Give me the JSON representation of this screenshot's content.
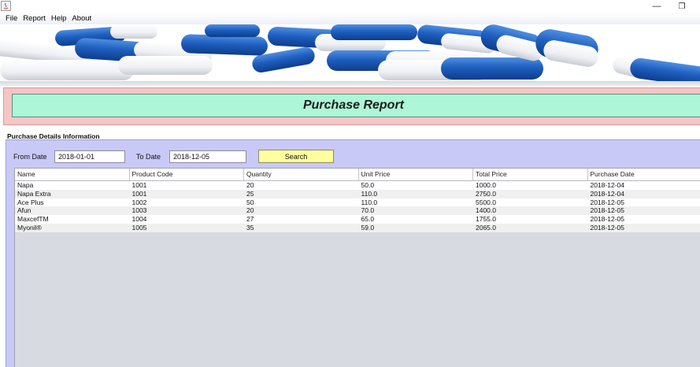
{
  "menu": {
    "items": [
      "File",
      "Report",
      "Help",
      "About"
    ]
  },
  "window": {
    "minimize_glyph": "—",
    "restore_glyph": "❐"
  },
  "header": {
    "title": "Purchase Report"
  },
  "filters": {
    "section_label": "Purchase Details Information",
    "from_label": "From Date",
    "from_value": "2018-01-01",
    "to_label": "To Date",
    "to_value": "2018-12-05",
    "search_label": "Search"
  },
  "table": {
    "columns": [
      "Name",
      "Product Code",
      "Quantity",
      "Unit Price",
      "Total Price",
      "Purchase Date"
    ],
    "rows": [
      [
        "Napa",
        "1001",
        "20",
        "50.0",
        "1000.0",
        "2018-12-04"
      ],
      [
        "Napa Extra",
        "1001",
        "25",
        "110.0",
        "2750.0",
        "2018-12-04"
      ],
      [
        "Ace Plus",
        "1002",
        "50",
        "110.0",
        "5500.0",
        "2018-12-05"
      ],
      [
        "Afun",
        "1003",
        "20",
        "70.0",
        "1400.0",
        "2018-12-05"
      ],
      [
        "MaxcefTM",
        "1004",
        "27",
        "65.0",
        "1755.0",
        "2018-12-05"
      ],
      [
        "Myonil®",
        "1005",
        "35",
        "59.0",
        "2065.0",
        "2018-12-05"
      ]
    ]
  },
  "colors": {
    "title_panel": "#f4c6c6",
    "title_inner": "#adf6d8",
    "details_panel": "#c9c9f7",
    "search_button": "#ffff9e",
    "pill_blue": "#1f5fb8"
  }
}
